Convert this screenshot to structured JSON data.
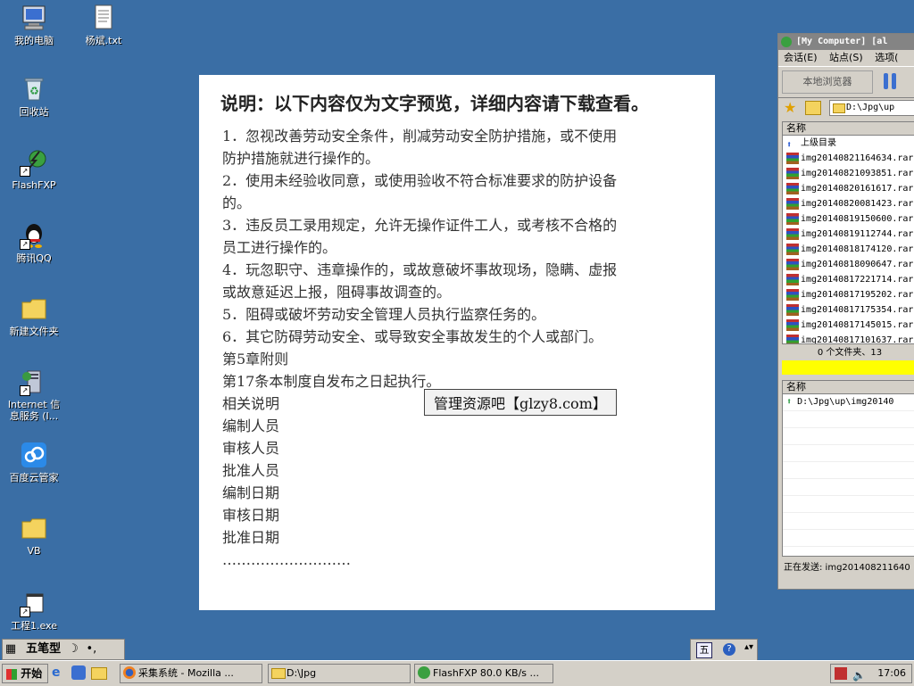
{
  "desktop": {
    "icons": [
      {
        "label": "我的电脑",
        "icon": "computer-icon"
      },
      {
        "label": "杨斌.txt",
        "icon": "text-file-icon"
      },
      {
        "label": "回收站",
        "icon": "recycle-bin-icon"
      },
      {
        "label": "FlashFXP",
        "icon": "flashfxp-icon"
      },
      {
        "label": "腾讯QQ",
        "icon": "qq-penguin-icon"
      },
      {
        "label": "新建文件夹",
        "icon": "folder-icon"
      },
      {
        "label": "Internet 信",
        "label2": "息服务 (I...",
        "icon": "iis-server-icon"
      },
      {
        "label": "百度云管家",
        "icon": "baidu-cloud-icon"
      },
      {
        "label": "VB",
        "icon": "folder-icon"
      },
      {
        "label": "工程1.exe",
        "icon": "exe-icon"
      }
    ]
  },
  "document": {
    "title": "说明：以下内容仅为文字预览，详细内容请下载查看。",
    "lines": [
      "1．忽视改善劳动安全条件，削减劳动安全防护措施，或不使用",
      "防护措施就进行操作的。",
      "2．使用未经验收同意，或使用验收不符合标准要求的防护设备",
      "的。",
      "3．违反员工录用规定，允许无操作证件工人，或考核不合格的",
      "员工进行操作的。",
      "4．玩忽职守、违章操作的，或故意破坏事故现场，隐瞒、虚报",
      "或故意延迟上报，阻碍事故调查的。",
      "5．阻碍或破坏劳动安全管理人员执行监察任务的。",
      "6．其它防碍劳动安全、或导致安全事故发生的个人或部门。",
      "第5章附则",
      "第17条本制度自发布之日起执行。",
      "相关说明",
      "编制人员",
      "审核人员",
      "批准人员",
      "编制日期",
      "审核日期",
      "批准日期",
      "………………………"
    ],
    "watermark": "管理资源吧【glzy8.com】"
  },
  "flashfxp": {
    "title": "[My Computer]  [al",
    "menu": [
      "会话(E)",
      "站点(S)",
      "选项("
    ],
    "local_browser": "本地浏览器",
    "address": "D:\\Jpg\\up",
    "column_name": "名称",
    "files": [
      "上级目录",
      "img20140821164634.rar",
      "img20140821093851.rar",
      "img20140820161617.rar",
      "img20140820081423.rar",
      "img20140819150600.rar",
      "img20140819112744.rar",
      "img20140818174120.rar",
      "img20140818090647.rar",
      "img20140817221714.rar",
      "img20140817195202.rar",
      "img20140817175354.rar",
      "img20140817145015.rar",
      "img20140817101637.rar"
    ],
    "status": "0 个文件夹、13",
    "queue_column": "名称",
    "queue_item": "D:\\Jpg\\up\\img20140",
    "sending": "正在发送: img201408211640"
  },
  "ime": {
    "name": "五笔型"
  },
  "taskbar": {
    "start": "开始",
    "tasks": [
      {
        "label": "采集系统 - Mozilla ...",
        "icon": "firefox-icon"
      },
      {
        "label": "D:\\Jpg",
        "icon": "folder-icon"
      },
      {
        "label": "FlashFXP 80.0 KB/s ...",
        "icon": "flashfxp-icon"
      }
    ],
    "clock": "17:06"
  }
}
